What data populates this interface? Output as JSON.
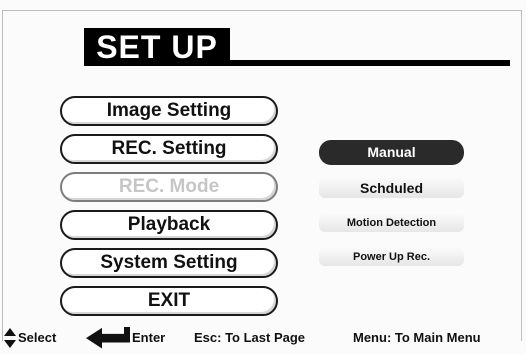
{
  "title": "SET UP",
  "menu": {
    "items": [
      {
        "label": "Image Setting",
        "enabled": true
      },
      {
        "label": "REC. Setting",
        "enabled": true
      },
      {
        "label": "REC. Mode",
        "enabled": false
      },
      {
        "label": "Playback",
        "enabled": true
      },
      {
        "label": "System Setting",
        "enabled": true
      },
      {
        "label": "EXIT",
        "enabled": true
      }
    ]
  },
  "rec_mode_options": {
    "items": [
      {
        "label": "Manual",
        "selected": true
      },
      {
        "label": "Schduled",
        "selected": false
      },
      {
        "label": "Motion Detection",
        "selected": false
      },
      {
        "label": "Power Up Rec.",
        "selected": false
      }
    ]
  },
  "hints": {
    "select": "Select",
    "enter": "Enter",
    "esc": "Esc: To Last Page",
    "menu": "Menu: To Main Menu"
  },
  "icons": {
    "select": "up-down-arrow-icon",
    "enter": "enter-arrow-icon"
  },
  "colors": {
    "background": "#fbfbfb",
    "title_bg": "#000000",
    "selected_option_bg": "#2a2a2a",
    "disabled_text": "#c6c6c6"
  }
}
